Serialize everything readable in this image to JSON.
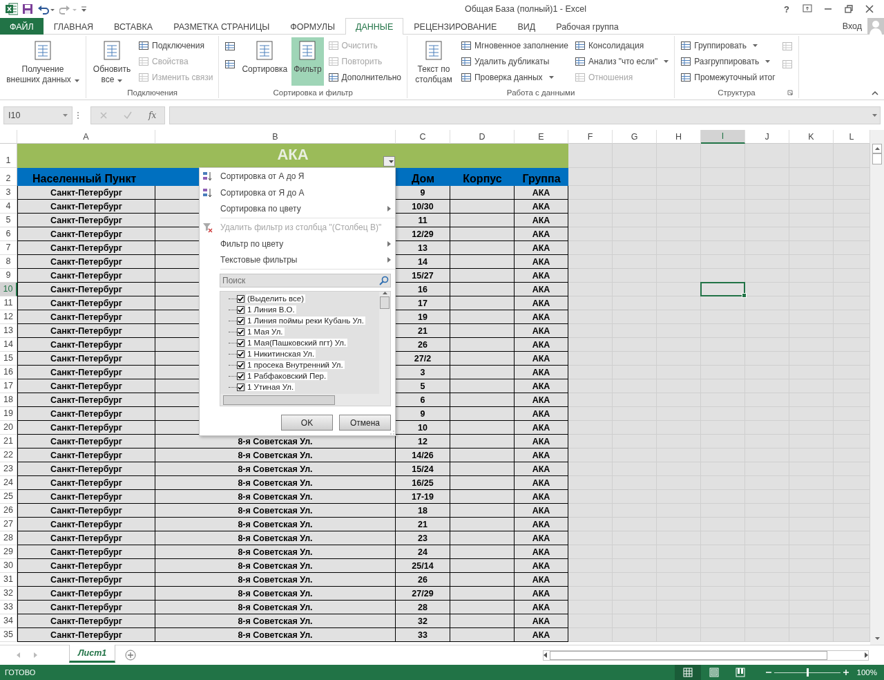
{
  "title_bar": {
    "title": "Общая База (полный)1 - Excel",
    "help": "?"
  },
  "ribbon_tabs": [
    {
      "label": "ФАЙЛ",
      "kind": "file",
      "selected": false
    },
    {
      "label": "ГЛАВНАЯ",
      "kind": "tab",
      "selected": false
    },
    {
      "label": "ВСТАВКА",
      "kind": "tab",
      "selected": false
    },
    {
      "label": "РАЗМЕТКА СТРАНИЦЫ",
      "kind": "tab",
      "selected": false
    },
    {
      "label": "ФОРМУЛЫ",
      "kind": "tab",
      "selected": false
    },
    {
      "label": "ДАННЫЕ",
      "kind": "tab",
      "selected": true
    },
    {
      "label": "РЕЦЕНЗИРОВАНИЕ",
      "kind": "tab",
      "selected": false
    },
    {
      "label": "ВИД",
      "kind": "tab",
      "selected": false
    },
    {
      "label": "Рабочая группа",
      "kind": "tab",
      "selected": false
    }
  ],
  "account": {
    "label": "Вход"
  },
  "ribbon_groups": [
    {
      "columns": [
        [
          {
            "kind": "large",
            "label": "Получение внешних данных",
            "dropdown": true,
            "disabled": false,
            "selected": false
          }
        ]
      ]
    },
    {
      "label": "Подключения",
      "columns": [
        [
          {
            "kind": "large",
            "label": "Обновить все",
            "dropdown": true,
            "disabled": false,
            "selected": false
          }
        ],
        [
          {
            "kind": "small",
            "label": "Подключения",
            "dropdown": false,
            "disabled": false
          },
          {
            "kind": "small",
            "label": "Свойства",
            "dropdown": false,
            "disabled": true
          },
          {
            "kind": "small",
            "label": "Изменить связи",
            "dropdown": false,
            "disabled": true
          }
        ]
      ]
    },
    {
      "label": "Сортировка и фильтр",
      "columns": [
        [
          {
            "kind": "icon",
            "disabled": false
          },
          {
            "kind": "icon",
            "disabled": false
          }
        ],
        [
          {
            "kind": "large",
            "label": "Сортировка",
            "dropdown": false,
            "disabled": false,
            "selected": false
          }
        ],
        [
          {
            "kind": "large",
            "label": "Фильтр",
            "dropdown": false,
            "disabled": false,
            "selected": true
          }
        ],
        [
          {
            "kind": "small",
            "label": "Очистить",
            "dropdown": false,
            "disabled": true
          },
          {
            "kind": "small",
            "label": "Повторить",
            "dropdown": false,
            "disabled": true
          },
          {
            "kind": "small",
            "label": "Дополнительно",
            "dropdown": false,
            "disabled": false
          }
        ]
      ]
    },
    {
      "label": "Работа с данными",
      "columns": [
        [
          {
            "kind": "large",
            "label": "Текст по столбцам",
            "dropdown": false,
            "disabled": false,
            "selected": false
          }
        ],
        [
          {
            "kind": "small",
            "label": "Мгновенное заполнение",
            "dropdown": false,
            "disabled": false
          },
          {
            "kind": "small",
            "label": "Удалить дубликаты",
            "dropdown": false,
            "disabled": false
          },
          {
            "kind": "small",
            "label": "Проверка данных",
            "dropdown": true,
            "disabled": false
          }
        ],
        [
          {
            "kind": "small",
            "label": "Консолидация",
            "dropdown": false,
            "disabled": false
          },
          {
            "kind": "small",
            "label": "Анализ \"что если\"",
            "dropdown": true,
            "disabled": false
          },
          {
            "kind": "small",
            "label": "Отношения",
            "dropdown": false,
            "disabled": true
          }
        ]
      ]
    },
    {
      "label": "Структура",
      "columns": [
        [
          {
            "kind": "small",
            "label": "Группировать",
            "dropdown": true,
            "disabled": false
          },
          {
            "kind": "small",
            "label": "Разгруппировать",
            "dropdown": true,
            "disabled": false
          },
          {
            "kind": "small",
            "label": "Промежуточный итог",
            "dropdown": false,
            "disabled": false
          }
        ],
        [
          {
            "kind": "icon",
            "disabled": true
          },
          {
            "kind": "icon",
            "disabled": true
          }
        ]
      ]
    }
  ],
  "formula_bar": {
    "name_box": "I10",
    "function_label": "fx"
  },
  "columns": [
    {
      "label": "A",
      "selected": false
    },
    {
      "label": "B",
      "selected": false
    },
    {
      "label": "C",
      "selected": false
    },
    {
      "label": "D",
      "selected": false
    },
    {
      "label": "E",
      "selected": false
    },
    {
      "label": "F",
      "selected": false
    },
    {
      "label": "G",
      "selected": false
    },
    {
      "label": "H",
      "selected": false
    },
    {
      "label": "I",
      "selected": true
    },
    {
      "label": "J",
      "selected": false
    },
    {
      "label": "K",
      "selected": false
    },
    {
      "label": "L",
      "selected": false
    }
  ],
  "rows": [
    {
      "number": "1",
      "kind": "title",
      "selected": false,
      "title": "АКА"
    },
    {
      "number": "2",
      "kind": "header",
      "selected": false,
      "a": "Населенный Пункт",
      "c": "Дом",
      "d": "Корпус",
      "e": "Группа"
    },
    {
      "number": "3",
      "kind": "data",
      "selected": false,
      "a": "Санкт-Петербург",
      "c": "9",
      "e": "АКА"
    },
    {
      "number": "4",
      "kind": "data",
      "selected": false,
      "a": "Санкт-Петербург",
      "c": "10/30",
      "e": "АКА"
    },
    {
      "number": "5",
      "kind": "data",
      "selected": false,
      "a": "Санкт-Петербург",
      "c": "11",
      "e": "АКА"
    },
    {
      "number": "6",
      "kind": "data",
      "selected": false,
      "a": "Санкт-Петербург",
      "c": "12/29",
      "e": "АКА"
    },
    {
      "number": "7",
      "kind": "data",
      "selected": false,
      "a": "Санкт-Петербург",
      "c": "13",
      "e": "АКА"
    },
    {
      "number": "8",
      "kind": "data",
      "selected": false,
      "a": "Санкт-Петербург",
      "c": "14",
      "e": "АКА"
    },
    {
      "number": "9",
      "kind": "data",
      "selected": false,
      "a": "Санкт-Петербург",
      "c": "15/27",
      "e": "АКА"
    },
    {
      "number": "10",
      "kind": "data",
      "selected": true,
      "a": "Санкт-Петербург",
      "c": "16",
      "e": "АКА"
    },
    {
      "number": "11",
      "kind": "data",
      "selected": false,
      "a": "Санкт-Петербург",
      "c": "17",
      "e": "АКА"
    },
    {
      "number": "12",
      "kind": "data",
      "selected": false,
      "a": "Санкт-Петербург",
      "c": "19",
      "e": "АКА"
    },
    {
      "number": "13",
      "kind": "data",
      "selected": false,
      "a": "Санкт-Петербург",
      "c": "21",
      "e": "АКА"
    },
    {
      "number": "14",
      "kind": "data",
      "selected": false,
      "a": "Санкт-Петербург",
      "c": "26",
      "e": "АКА"
    },
    {
      "number": "15",
      "kind": "data",
      "selected": false,
      "a": "Санкт-Петербург",
      "c": "27/2",
      "e": "АКА"
    },
    {
      "number": "16",
      "kind": "data",
      "selected": false,
      "a": "Санкт-Петербург",
      "c": "3",
      "e": "АКА"
    },
    {
      "number": "17",
      "kind": "data",
      "selected": false,
      "a": "Санкт-Петербург",
      "c": "5",
      "e": "АКА"
    },
    {
      "number": "18",
      "kind": "data",
      "selected": false,
      "a": "Санкт-Петербург",
      "c": "6",
      "e": "АКА"
    },
    {
      "number": "19",
      "kind": "data",
      "selected": false,
      "a": "Санкт-Петербург",
      "c": "9",
      "e": "АКА"
    },
    {
      "number": "20",
      "kind": "data",
      "selected": false,
      "a": "Санкт-Петербург",
      "c": "10",
      "e": "АКА"
    },
    {
      "number": "21",
      "kind": "data",
      "selected": false,
      "a": "Санкт-Петербург",
      "b": "8-я Советская Ул.",
      "c": "12",
      "e": "АКА"
    },
    {
      "number": "22",
      "kind": "data",
      "selected": false,
      "a": "Санкт-Петербург",
      "b": "8-я Советская Ул.",
      "c": "14/26",
      "e": "АКА"
    },
    {
      "number": "23",
      "kind": "data",
      "selected": false,
      "a": "Санкт-Петербург",
      "b": "8-я Советская Ул.",
      "c": "15/24",
      "e": "АКА"
    },
    {
      "number": "24",
      "kind": "data",
      "selected": false,
      "a": "Санкт-Петербург",
      "b": "8-я Советская Ул.",
      "c": "16/25",
      "e": "АКА"
    },
    {
      "number": "25",
      "kind": "data",
      "selected": false,
      "a": "Санкт-Петербург",
      "b": "8-я Советская Ул.",
      "c": "17-19",
      "e": "АКА"
    },
    {
      "number": "26",
      "kind": "data",
      "selected": false,
      "a": "Санкт-Петербург",
      "b": "8-я Советская Ул.",
      "c": "18",
      "e": "АКА"
    },
    {
      "number": "27",
      "kind": "data",
      "selected": false,
      "a": "Санкт-Петербург",
      "b": "8-я Советская Ул.",
      "c": "21",
      "e": "АКА"
    },
    {
      "number": "28",
      "kind": "data",
      "selected": false,
      "a": "Санкт-Петербург",
      "b": "8-я Советская Ул.",
      "c": "23",
      "e": "АКА"
    },
    {
      "number": "29",
      "kind": "data",
      "selected": false,
      "a": "Санкт-Петербург",
      "b": "8-я Советская Ул.",
      "c": "24",
      "e": "АКА"
    },
    {
      "number": "30",
      "kind": "data",
      "selected": false,
      "a": "Санкт-Петербург",
      "b": "8-я Советская Ул.",
      "c": "25/14",
      "e": "АКА"
    },
    {
      "number": "31",
      "kind": "data",
      "selected": false,
      "a": "Санкт-Петербург",
      "b": "8-я Советская Ул.",
      "c": "26",
      "e": "АКА"
    },
    {
      "number": "32",
      "kind": "data",
      "selected": false,
      "a": "Санкт-Петербург",
      "b": "8-я Советская Ул.",
      "c": "27/29",
      "e": "АКА"
    },
    {
      "number": "33",
      "kind": "data",
      "selected": false,
      "a": "Санкт-Петербург",
      "b": "8-я Советская Ул.",
      "c": "28",
      "e": "АКА"
    },
    {
      "number": "34",
      "kind": "data",
      "selected": false,
      "a": "Санкт-Петербург",
      "b": "8-я Советская Ул.",
      "c": "32",
      "e": "АКА"
    },
    {
      "number": "35",
      "kind": "data",
      "selected": false,
      "a": "Санкт-Петербург",
      "b": "8-я Советская Ул.",
      "c": "33",
      "e": "АКА"
    }
  ],
  "filter_menu": {
    "items": [
      {
        "kind": "sort_asc",
        "label": "Сортировка от А до Я",
        "disabled": false,
        "submenu": false
      },
      {
        "kind": "sort_desc",
        "label": "Сортировка от Я до А",
        "disabled": false,
        "submenu": false
      },
      {
        "kind": "plain",
        "label": "Сортировка по цвету",
        "disabled": false,
        "submenu": true
      },
      {
        "kind": "clear",
        "label": "Удалить фильтр из столбца \"(Столбец B)\"",
        "disabled": true,
        "submenu": false
      },
      {
        "kind": "plain",
        "label": "Фильтр по цвету",
        "disabled": false,
        "submenu": true
      },
      {
        "kind": "plain",
        "label": "Текстовые фильтры",
        "disabled": false,
        "submenu": true
      }
    ],
    "search": {
      "placeholder": "Поиск"
    },
    "values": [
      {
        "label": "(Выделить все)",
        "checked": true
      },
      {
        "label": "1 Линия В.О.",
        "checked": true
      },
      {
        "label": "1 Линия поймы реки Кубань Ул.",
        "checked": true
      },
      {
        "label": "1 Мая Ул.",
        "checked": true
      },
      {
        "label": "1 Мая(Пашковский пгт) Ул.",
        "checked": true
      },
      {
        "label": "1 Никитинская Ул.",
        "checked": true
      },
      {
        "label": "1 просека Внутренний Ул.",
        "checked": true
      },
      {
        "label": "1 Рабфаковский Пер.",
        "checked": true
      },
      {
        "label": "1 Утиная Ул.",
        "checked": true
      }
    ],
    "buttons": [
      "OK",
      "Отмена"
    ]
  },
  "sheet_tabs": [
    {
      "label": "Лист1",
      "selected": true
    }
  ],
  "status_bar": {
    "status": "ГОТОВО",
    "views": [
      {
        "kind": "normal",
        "selected": true
      },
      {
        "kind": "page_layout",
        "selected": false
      },
      {
        "kind": "page_break",
        "selected": false
      }
    ],
    "zoom": {
      "level": 0.5,
      "reading": "100%"
    }
  }
}
